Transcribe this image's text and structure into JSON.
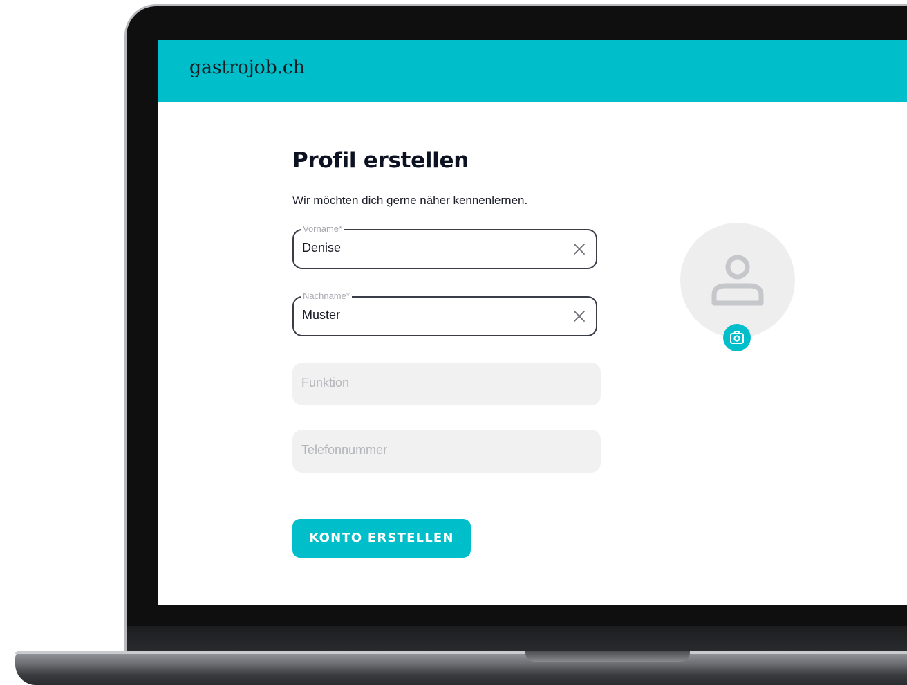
{
  "app": {
    "logo": "gastrojob.ch",
    "brand_color": "#00bfcb"
  },
  "form": {
    "title": "Profil erstellen",
    "subtitle": "Wir möchten dich gerne näher kennenlernen.",
    "fields": [
      {
        "label": "Vorname*",
        "value": "Denise",
        "clear_icon": "close-icon"
      },
      {
        "label": "Nachname*",
        "value": "Muster",
        "clear_icon": "close-icon"
      },
      {
        "placeholder": "Funktion",
        "value": ""
      },
      {
        "placeholder": "Telefonnummer",
        "value": ""
      }
    ],
    "submit_label": "KONTO ERSTELLEN"
  },
  "avatar": {
    "icon": "user-icon",
    "upload_icon": "camera-icon"
  }
}
